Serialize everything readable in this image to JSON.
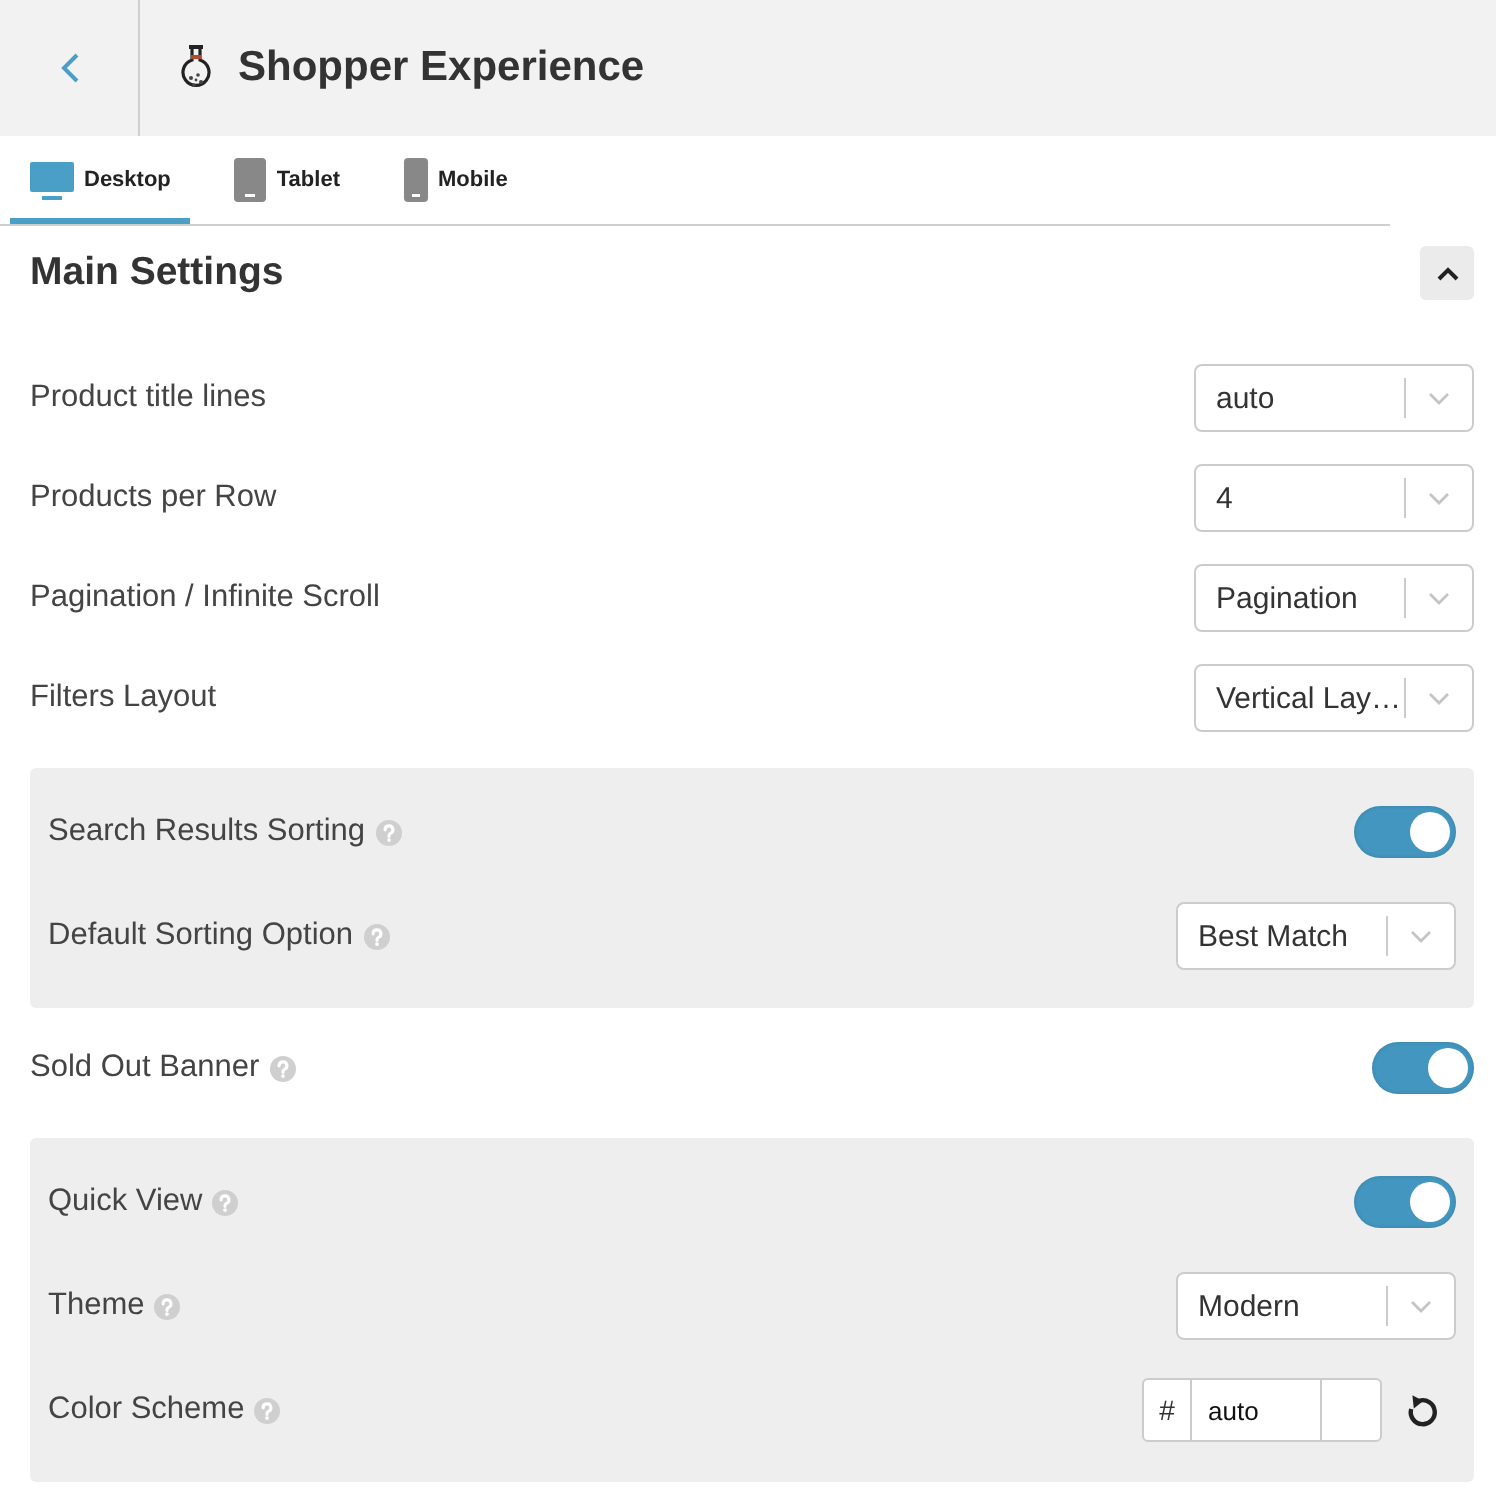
{
  "header": {
    "title": "Shopper Experience"
  },
  "tabs": [
    {
      "kind": "desktop",
      "label": "Desktop",
      "selected": true
    },
    {
      "kind": "tablet",
      "label": "Tablet",
      "selected": false
    },
    {
      "kind": "mobile",
      "label": "Mobile",
      "selected": false
    }
  ],
  "main_settings": {
    "title": "Main Settings",
    "expanded": true,
    "items": [
      {
        "kind": "select",
        "label": "Product title lines",
        "help": false,
        "value": "auto"
      },
      {
        "kind": "select",
        "label": "Products per Row",
        "help": false,
        "value": "4"
      },
      {
        "kind": "select",
        "label": "Pagination / Infinite Scroll",
        "help": false,
        "value": "Pagination"
      },
      {
        "kind": "select",
        "label": "Filters Layout",
        "help": false,
        "value": "Vertical Lay…"
      },
      {
        "kind": "group",
        "rows": [
          {
            "kind": "toggle",
            "label": "Search Results Sorting",
            "help": true,
            "on": true
          },
          {
            "kind": "select",
            "label": "Default Sorting Option",
            "help": true,
            "value": "Best Match"
          }
        ]
      },
      {
        "kind": "toggle",
        "label": "Sold Out Banner",
        "help": true,
        "on": true
      },
      {
        "kind": "group",
        "rows": [
          {
            "kind": "toggle",
            "label": "Quick View",
            "help": true,
            "on": true
          },
          {
            "kind": "select",
            "label": "Theme",
            "help": true,
            "value": "Modern"
          },
          {
            "kind": "color",
            "label": "Color Scheme",
            "help": true,
            "prefix": "#",
            "value": "auto"
          }
        ]
      }
    ]
  }
}
